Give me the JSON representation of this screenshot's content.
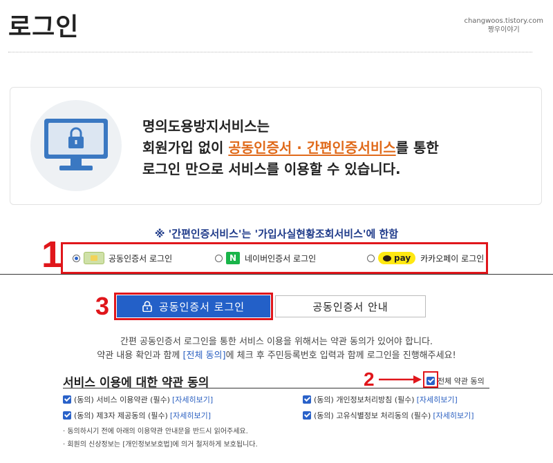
{
  "header": {
    "title": "로그인",
    "watermark_line1": "changwoos.tistory.com",
    "watermark_line2": "짱우이야기"
  },
  "info": {
    "line1": "명의도용방지서비스는",
    "line2_pre": "회원가입 없이 ",
    "line2_hl": "공동인증서 · 간편인증서비스",
    "line2_post": "를 통한",
    "line3": "로그인 만으로 서비스를 이용할 수 있습니다.",
    "icon": "locked-monitor-icon"
  },
  "notice": "※ '간편인증서비스'는 '가입사실현황조회서비스'에 한함",
  "annotations": {
    "n1": "1",
    "n2": "2",
    "n3": "3"
  },
  "login_options": {
    "cert": {
      "label": "공동인증서 로그인",
      "selected": true
    },
    "naver": {
      "badge": "N",
      "label": "네이버인증서 로그인",
      "selected": false
    },
    "kakao": {
      "badge": "pay",
      "label": "카카오페이 로그인",
      "selected": false
    }
  },
  "buttons": {
    "login": "공동인증서 로그인",
    "guide": "공동인증서 안내"
  },
  "description": {
    "line1": "간편 공동인증서 로그인을 통한 서비스 이용을 위해서는 약관 동의가 있어야 합니다.",
    "line2_pre": "약관 내용 확인과 함께 ",
    "line2_link": "[전체 동의]",
    "line2_post": "에 체크 후 주민등록번호 입력과 함께 로그인을 진행해주세요!"
  },
  "terms": {
    "title": "서비스 이용에 대한 약관 동의",
    "agree_all": "전체 약관 동의",
    "view_label": "[자세히보기]",
    "items": [
      {
        "label": "(동의) 서비스 이용약관 (필수)"
      },
      {
        "label": "(동의) 개인정보처리방침 (필수)"
      },
      {
        "label": "(동의) 제3자 제공동의 (필수)"
      },
      {
        "label": "(동의) 고유식별정보 처리동의 (필수)"
      }
    ],
    "note1": "· 동의하시기 전에 아래의 이용약관 안내문을 반드시 읽어주세요.",
    "note2": "· 회원의 신상정보는 [개인정보보호법]에 의거 철저하게 보호됩니다."
  },
  "colors": {
    "accent": "#2360c8",
    "highlight": "#e06a1a",
    "annotation": "#e0161b",
    "notice": "#1f3b8a"
  }
}
